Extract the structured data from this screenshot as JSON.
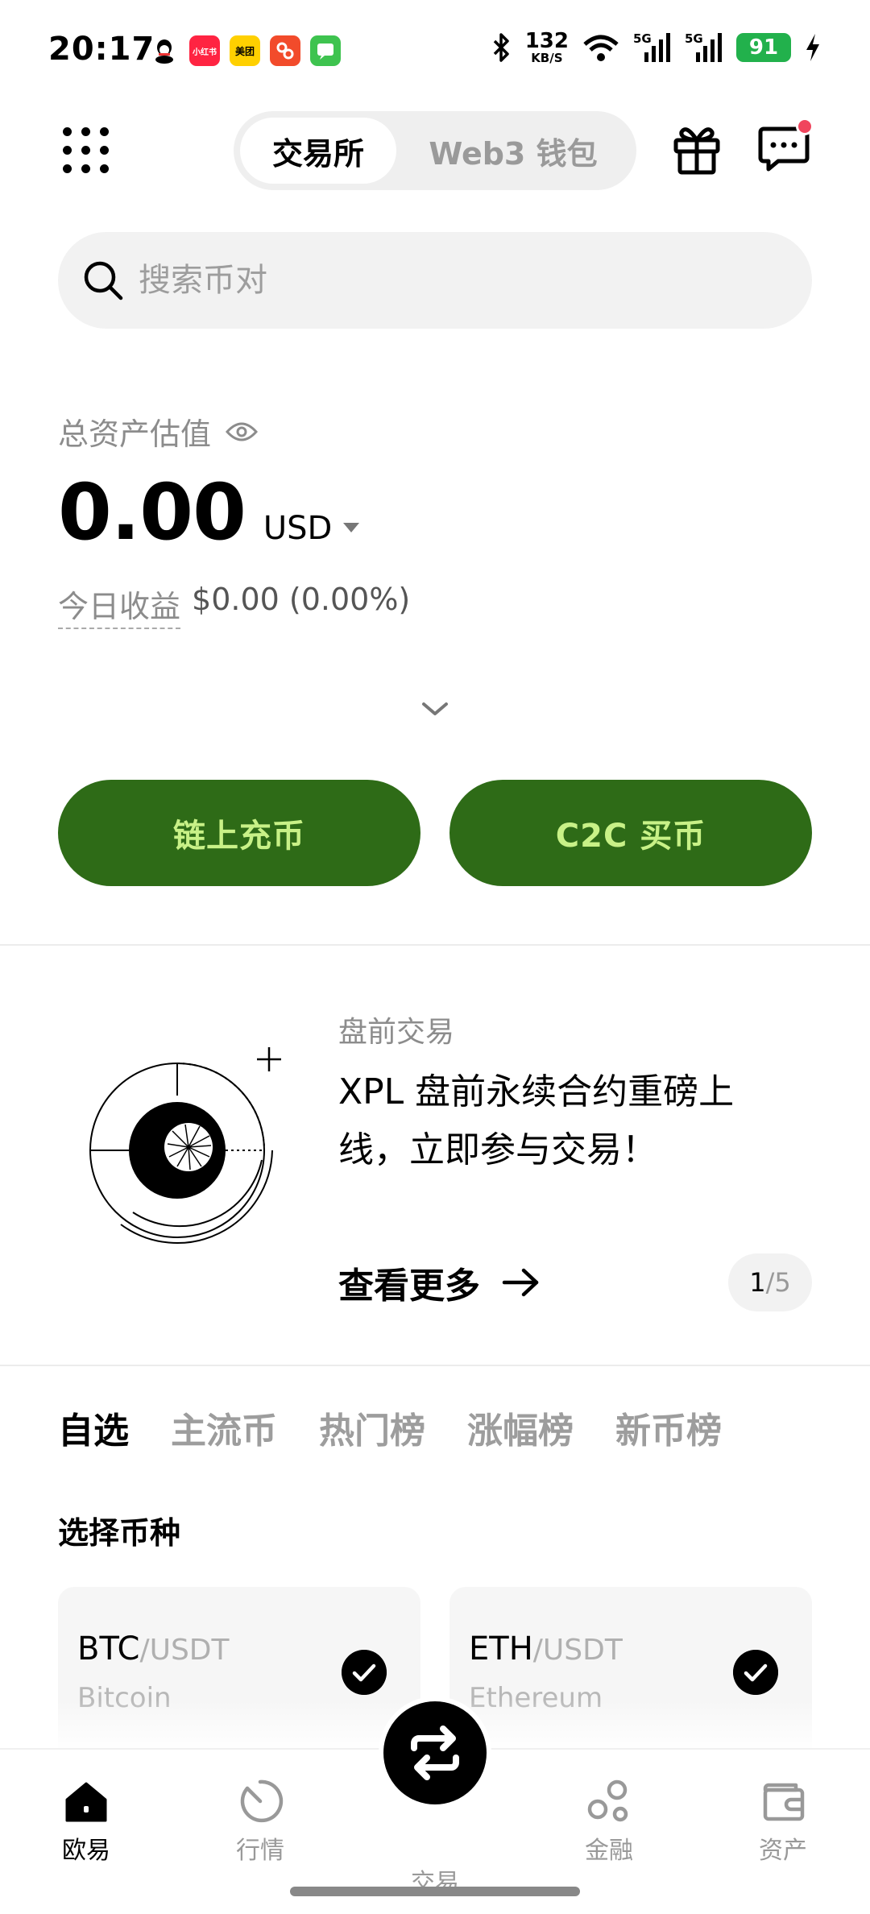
{
  "status_bar": {
    "time": "20:17",
    "net_speed_value": "132",
    "net_speed_unit": "KB/S",
    "signal1": "5G",
    "signal2": "5G",
    "battery": "91",
    "app_icons": [
      {
        "name": "qq",
        "color": "#ffffff",
        "text": ""
      },
      {
        "name": "xiaohongshu",
        "color": "#ff2442",
        "text": "小红书"
      },
      {
        "name": "meituan",
        "color": "#ffd000",
        "text": "美团"
      },
      {
        "name": "pinduoduo",
        "color": "#f24b2b",
        "text": ""
      },
      {
        "name": "messages",
        "color": "#3ec34f",
        "text": ""
      }
    ]
  },
  "header": {
    "tab_exchange": "交易所",
    "tab_wallet": "Web3 钱包"
  },
  "search": {
    "placeholder": "搜索币对"
  },
  "assets": {
    "label": "总资产估值",
    "value": "0.00",
    "currency": "USD",
    "today_label": "今日收益",
    "today_value": "$0.00 (0.00%)"
  },
  "actions": {
    "deposit": "链上充币",
    "c2c": "C2C 买币"
  },
  "banner": {
    "tag": "盘前交易",
    "title": "XPL 盘前永续合约重磅上线，立即参与交易！",
    "more": "查看更多",
    "page_current": "1",
    "page_total": "/5"
  },
  "market_tabs": [
    "自选",
    "主流币",
    "热门榜",
    "涨幅榜",
    "新币榜"
  ],
  "select_coins": {
    "title": "选择币种",
    "coins": [
      {
        "base": "BTC",
        "quote": "/USDT",
        "name": "Bitcoin"
      },
      {
        "base": "ETH",
        "quote": "/USDT",
        "name": "Ethereum"
      }
    ]
  },
  "bottom_nav": [
    {
      "label": "欧易"
    },
    {
      "label": "行情"
    },
    {
      "label": "交易"
    },
    {
      "label": "金融"
    },
    {
      "label": "资产"
    }
  ],
  "colors": {
    "brand_green": "#2e6b17",
    "brand_green_text": "#c8f187",
    "notification_dot": "#f0455d"
  }
}
